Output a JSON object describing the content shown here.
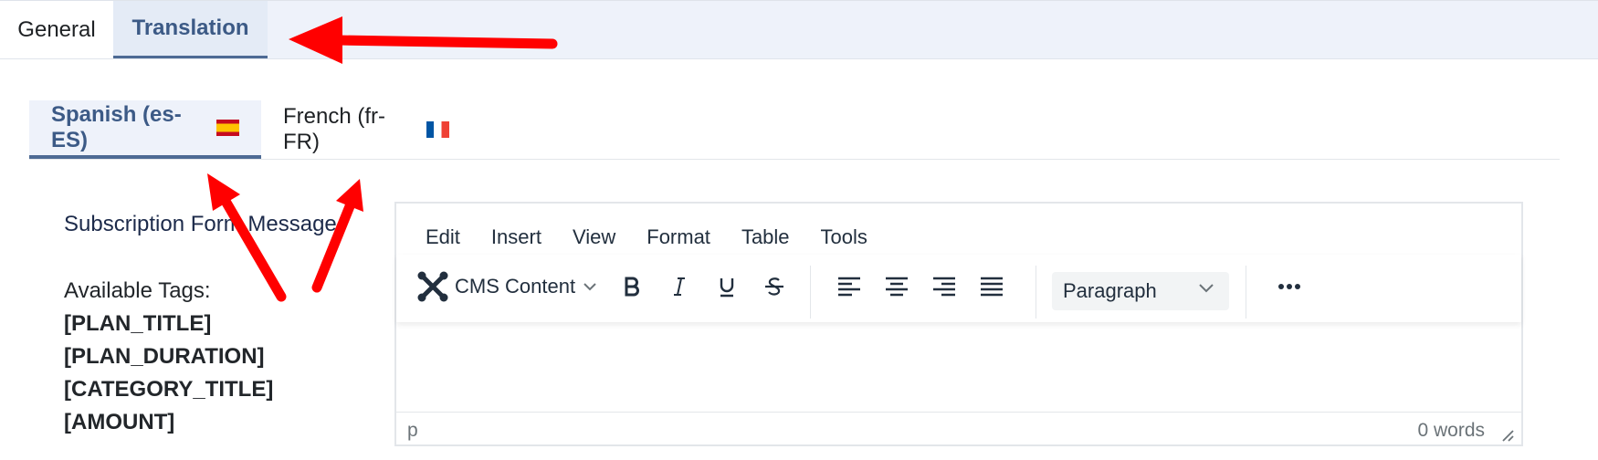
{
  "tabs": {
    "general": "General",
    "translation": "Translation"
  },
  "languages": [
    {
      "label": "Spanish (es-ES)",
      "flag": "spain-flag-icon"
    },
    {
      "label": "French (fr-FR)",
      "flag": "france-flag-icon"
    }
  ],
  "form": {
    "field_label": "Subscription Form Message",
    "tags_heading": "Available Tags:",
    "tags": [
      "[PLAN_TITLE]",
      "[PLAN_DURATION]",
      "[CATEGORY_TITLE]",
      "[AMOUNT]"
    ]
  },
  "editor": {
    "menu": [
      "Edit",
      "Insert",
      "View",
      "Format",
      "Table",
      "Tools"
    ],
    "cms_content": "CMS Content",
    "block_format": "Paragraph",
    "status_path": "p",
    "word_count": "0 words"
  },
  "colors": {
    "accent": "#3c5a86",
    "annotation_arrow": "#ff0000"
  }
}
